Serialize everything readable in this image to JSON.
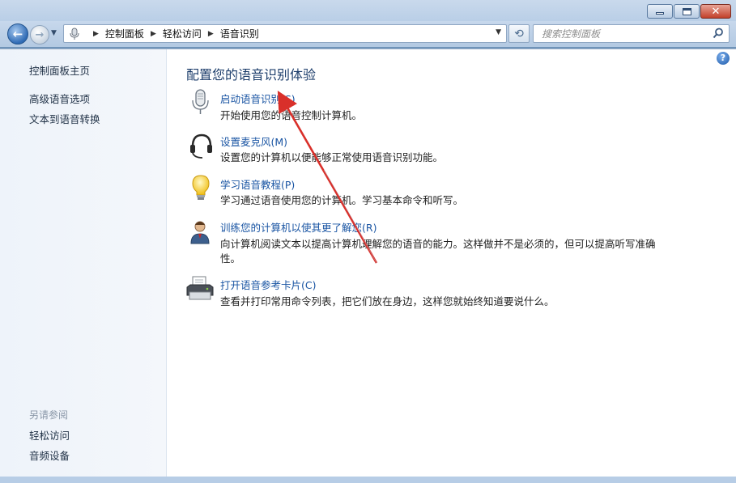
{
  "window": {
    "controls": [
      "minimize-button",
      "maximize-button",
      "close-button"
    ],
    "close_glyph": "✕"
  },
  "nav": {
    "breadcrumbs": [
      "控制面板",
      "轻松访问",
      "语音识别"
    ],
    "search_placeholder": "搜索控制面板"
  },
  "sidebar": {
    "home": "控制面板主页",
    "links": [
      "高级语音选项",
      "文本到语音转换"
    ],
    "see_also_header": "另请参阅",
    "see_also": [
      "轻松访问",
      "音频设备"
    ]
  },
  "main": {
    "title": "配置您的语音识别体验",
    "tasks": [
      {
        "icon": "microphone-icon",
        "link": "启动语音识别(S)",
        "desc": [
          "开始使用您的语音控制计算机。"
        ]
      },
      {
        "icon": "headset-icon",
        "link": "设置麦克风(M)",
        "desc": [
          "设置您的计算机以便能够正常使用语音识别功能。"
        ]
      },
      {
        "icon": "lightbulb-icon",
        "link": "学习语音教程(P)",
        "desc": [
          "学习通过语音使用您的计算机。学习基本命令和听写。"
        ]
      },
      {
        "icon": "user-training-icon",
        "link": "训练您的计算机以使其更了解您(R)",
        "desc": [
          "向计算机阅读文本以提高计算机理解您的语音的能力。这样做并不是必须的，但可以提高听写准确",
          "性。"
        ]
      },
      {
        "icon": "printer-icon",
        "link": "打开语音参考卡片(C)",
        "desc": [
          "查看并打印常用命令列表，把它们放在身边，这样您就始终知道要说什么。"
        ]
      }
    ]
  },
  "colors": {
    "link": "#1a55a3",
    "title": "#1c3d6b",
    "arrow": "#d9302a"
  }
}
